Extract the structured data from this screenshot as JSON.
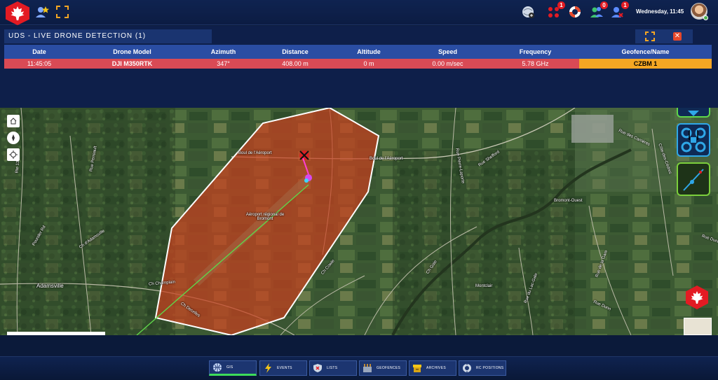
{
  "topbar": {
    "datetime": "Wednesday, 11:45",
    "badges": {
      "alerts": "1",
      "users": "0",
      "requests": "1"
    }
  },
  "panel": {
    "title": "UDS - LIVE DRONE DETECTION (1)",
    "close_label": "✕"
  },
  "table": {
    "columns": [
      "Date",
      "Drone Model",
      "Azimuth",
      "Distance",
      "Altitude",
      "Speed",
      "Frequency",
      "Geofence/Name"
    ],
    "rows": [
      [
        "11:45:05",
        "DJI M350RTK",
        "347°",
        "408.00 m",
        "0 m",
        "0.00 m/sec",
        "5.78 GHz",
        "CZBM 1"
      ]
    ]
  },
  "map": {
    "labels": {
      "road_aeroport_1": "Boul de l'Aéroport",
      "road_aeroport_2": "Boul de l'Aéroport",
      "airport": "Aéroport régional de Bromont",
      "town": "Adamsville",
      "chemin_davila": "Ch d'Adamsville",
      "rue_perreault": "Rue Perreault",
      "ch_champlain": "Ch Champlain",
      "ch_decelles": "Ch Decelles",
      "rue_pierre_laporte": "Rue Pierre-Laporte",
      "rue_shefford": "Rue Shefford",
      "rue_des_carrieres": "Rue des Carrières",
      "cote_des_cedres": "Côte-des-Cèdres",
      "ch_cowie": "Ch Cowie",
      "montclair": "Montclair",
      "rue_lac_gale": "Rue du Lac-Gale",
      "rue_dunn": "Rue Dunn",
      "rue_de_la_gare": "Rue de la Gare",
      "rue_1_39": "Rte 139",
      "ch_gale": "Ch Gale",
      "pounder": "Pounder Rd",
      "dunn_2": "Rue Dunn",
      "bromont_ouest": "Bromont-Ouest"
    },
    "geofence_color": "#c8401f",
    "flight_line_color": "#5fd64a"
  },
  "nav": {
    "items": [
      {
        "label": "GIS",
        "icon": "globe-icon",
        "active": true
      },
      {
        "label": "EVENTS",
        "icon": "lightning-icon",
        "active": false
      },
      {
        "label": "LISTS",
        "icon": "shield-icon",
        "active": false
      },
      {
        "label": "GEOFENCES",
        "icon": "geofence-icon",
        "active": false
      },
      {
        "label": "ARCHIVES",
        "icon": "archive-box-icon",
        "active": false
      },
      {
        "label": "RC POSITIONS",
        "icon": "rc-position-icon",
        "active": false
      }
    ]
  }
}
